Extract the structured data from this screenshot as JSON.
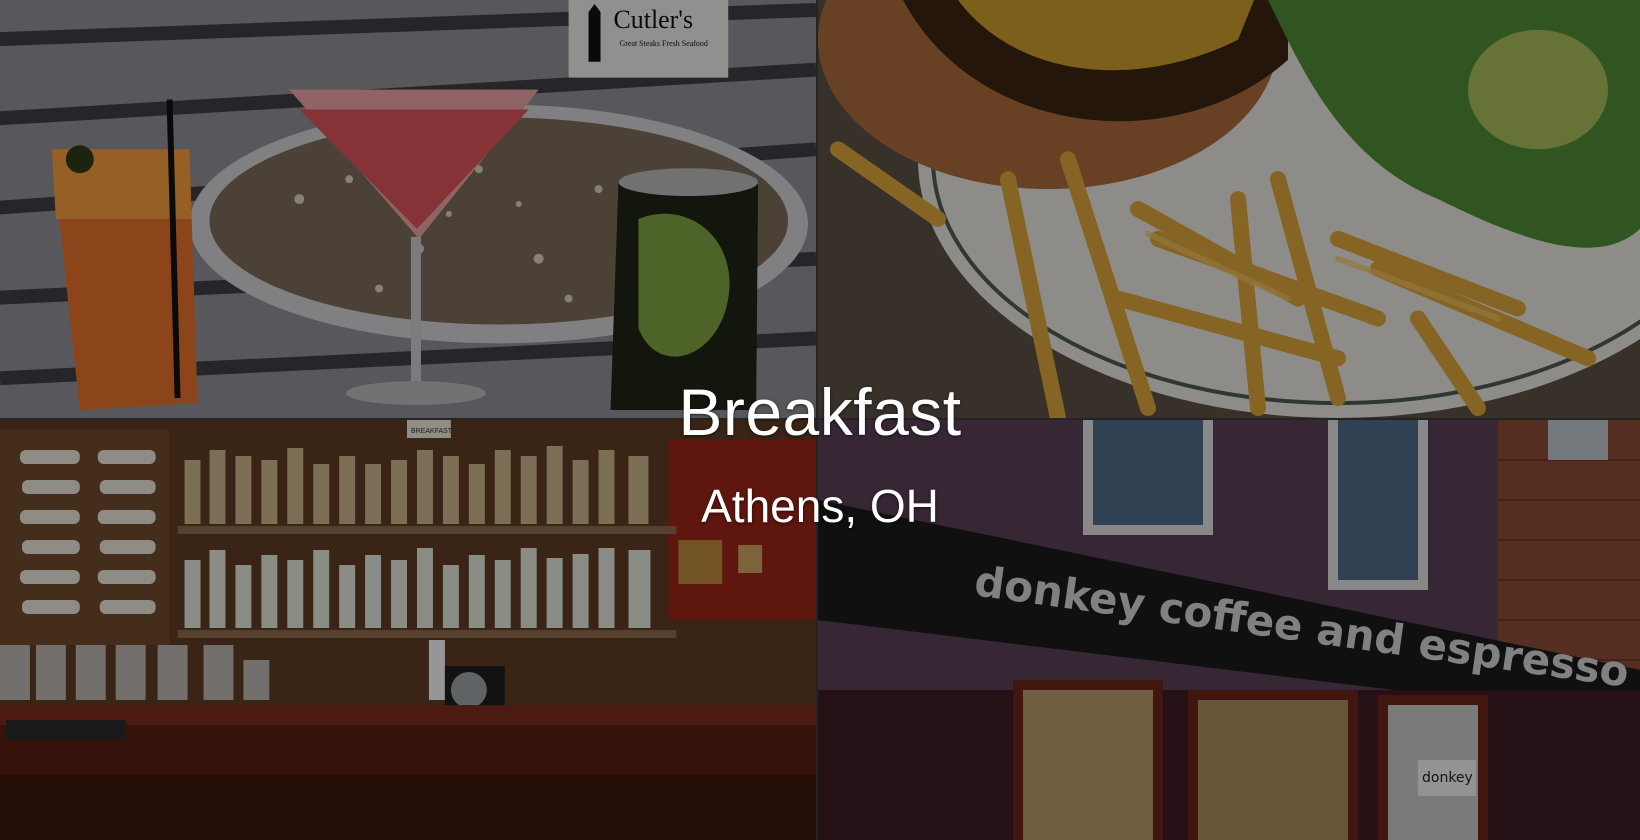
{
  "slide": {
    "title": "Breakfast",
    "location": "Athens, OH"
  },
  "tiles": {
    "drinks": {
      "sign_name": "Cutler's",
      "sign_tagline": "Great Steaks Fresh Seafood"
    },
    "burger": {},
    "bar": {
      "shelf_tag": "BREAKFAST"
    },
    "storefront": {
      "awning_text": "donkey coffee and espresso",
      "window_decal": "donkey"
    }
  },
  "colors": {
    "overlay": "#000000",
    "caption_text": "#ffffff"
  }
}
